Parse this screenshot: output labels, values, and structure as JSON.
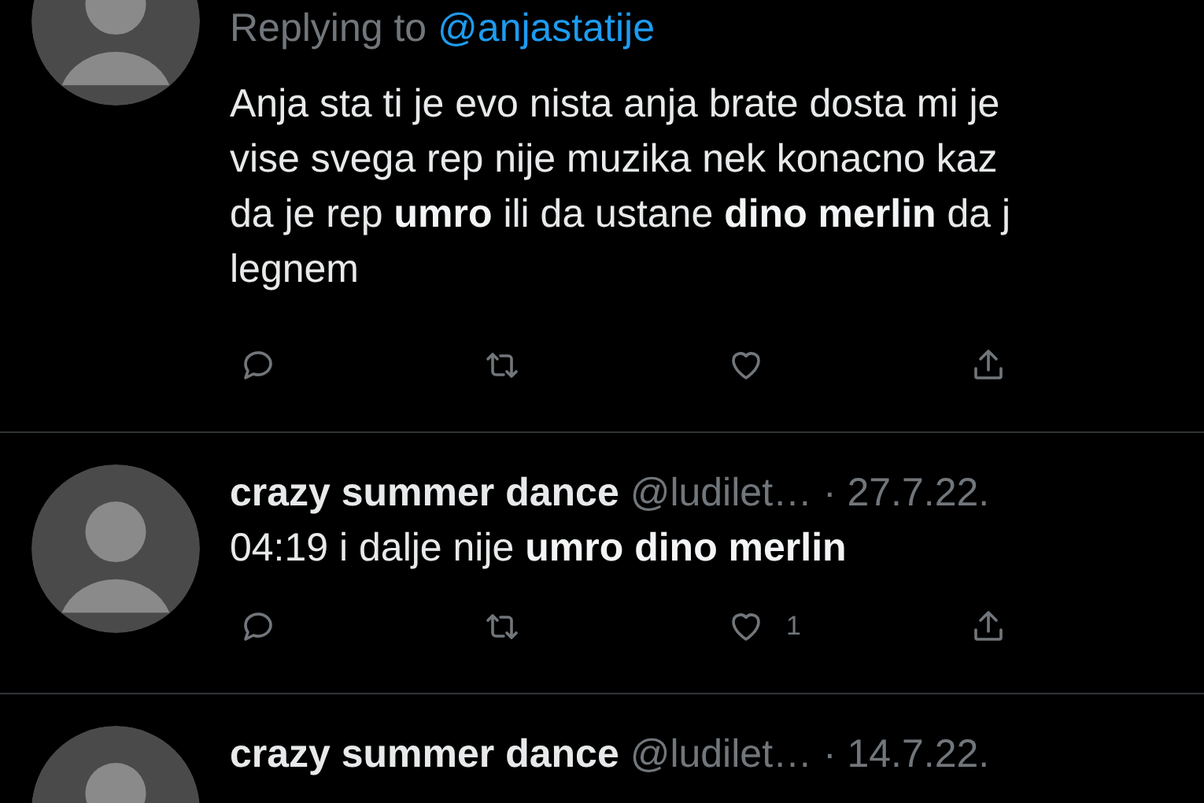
{
  "tweets": [
    {
      "replying_to": {
        "label": "Replying to",
        "handle": "@anjastatije"
      },
      "body_lines": [
        "Anja sta ti je evo nista anja brate dosta mi je",
        "vise svega rep nije muzika nek konacno kaz",
        "da je rep **umro** ili da ustane **dino merlin** da j",
        "legnem"
      ],
      "actions": [
        {
          "kind": "reply"
        },
        {
          "kind": "retweet"
        },
        {
          "kind": "like"
        },
        {
          "kind": "share"
        }
      ]
    },
    {
      "name": "crazy summer dance",
      "meta": "@ludilet… · 27.7.22.",
      "body_lines": [
        "04:19 i dalje nije **umro dino merlin**"
      ],
      "actions": [
        {
          "kind": "reply"
        },
        {
          "kind": "retweet"
        },
        {
          "kind": "like",
          "count": "1"
        },
        {
          "kind": "share"
        }
      ]
    },
    {
      "name": "crazy summer dance",
      "meta": "@ludilet… · 14.7.22."
    }
  ]
}
